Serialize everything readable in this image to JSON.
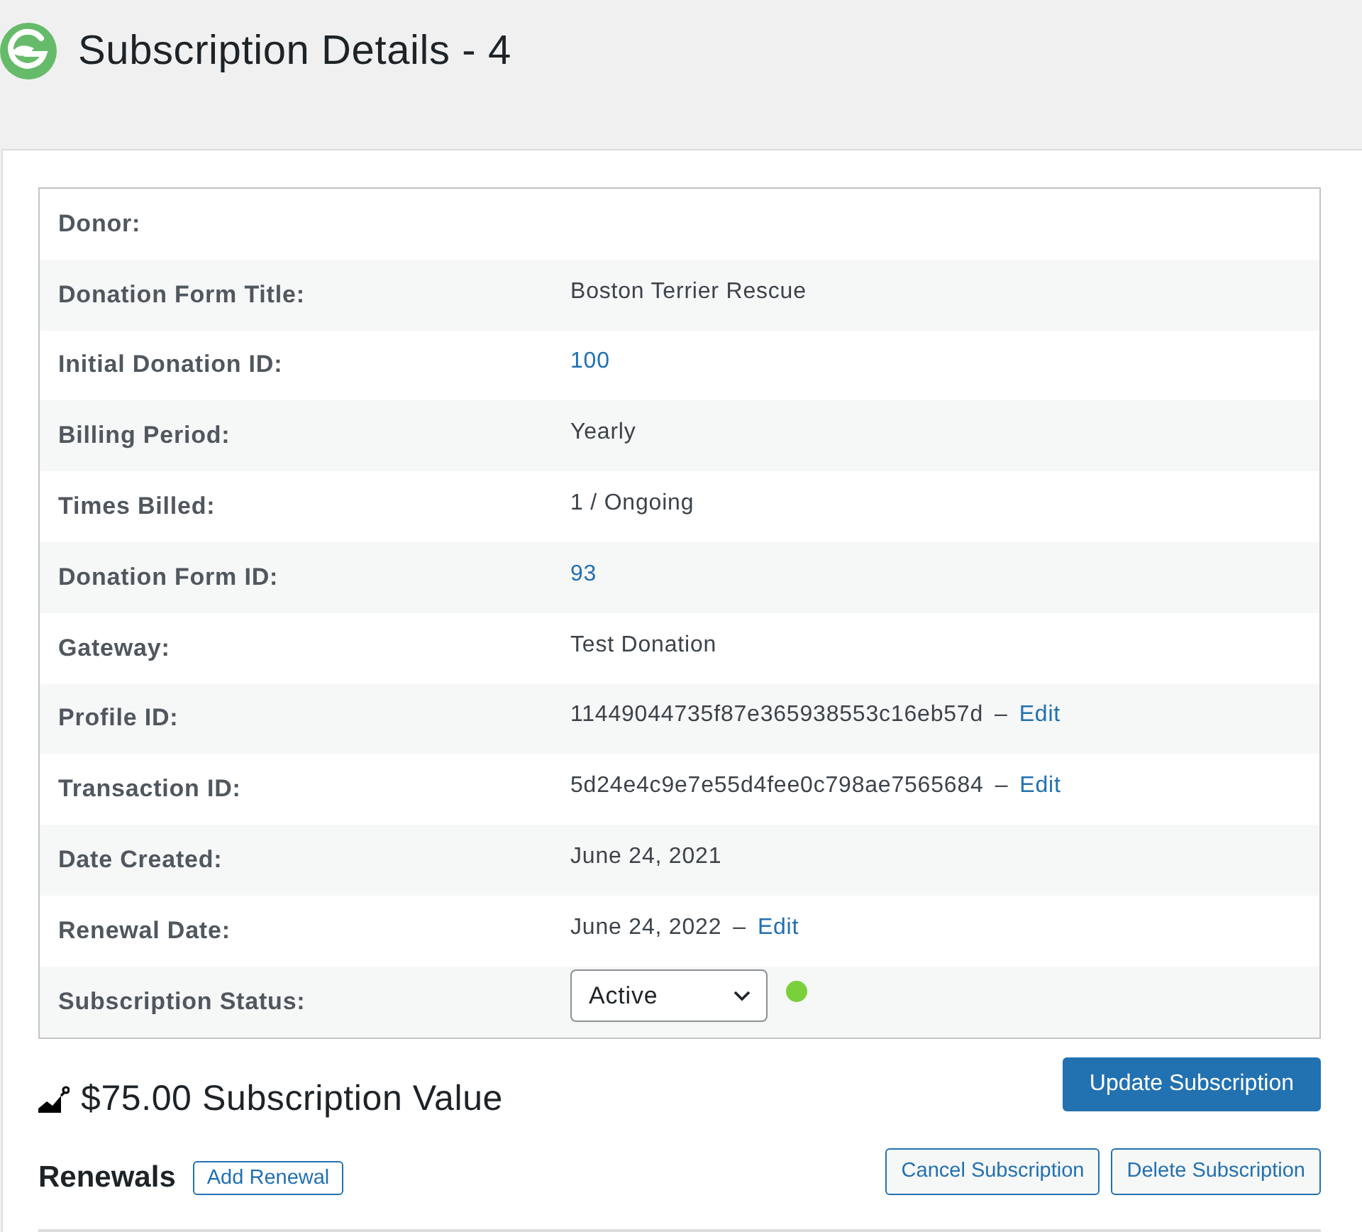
{
  "page": {
    "title": "Subscription Details - 4"
  },
  "details": [
    {
      "label": "Donor:",
      "kind": "text"
    },
    {
      "label": "Donation Form Title:",
      "kind": "text",
      "value": "Boston Terrier Rescue"
    },
    {
      "label": "Initial Donation ID:",
      "kind": "link",
      "value": "100"
    },
    {
      "label": "Billing Period:",
      "kind": "text",
      "value": "Yearly"
    },
    {
      "label": "Times Billed:",
      "kind": "text",
      "value": "1 / Ongoing"
    },
    {
      "label": "Donation Form ID:",
      "kind": "link",
      "value": "93"
    },
    {
      "label": "Gateway:",
      "kind": "text",
      "value": "Test Donation"
    },
    {
      "label": "Profile ID:",
      "kind": "editable",
      "value": "11449044735f87e365938553c16eb57d",
      "separator": "–",
      "action": "Edit"
    },
    {
      "label": "Transaction ID:",
      "kind": "editable",
      "value": "5d24e4c9e7e55d4fee0c798ae7565684",
      "separator": "–",
      "action": "Edit"
    },
    {
      "label": "Date Created:",
      "kind": "text",
      "value": "June 24, 2021"
    },
    {
      "label": "Renewal Date:",
      "kind": "editable",
      "value": "June 24, 2022",
      "separator": "–",
      "action": "Edit"
    },
    {
      "label": "Subscription Status:",
      "kind": "select",
      "value": "Active",
      "color": "#7ad03a"
    }
  ],
  "summary": {
    "value_text": "$75.00 Subscription Value",
    "update_button": "Update Subscription"
  },
  "renewals": {
    "heading": "Renewals",
    "add_button": "Add Renewal",
    "actions": [
      "Cancel Subscription",
      "Delete Subscription"
    ]
  }
}
